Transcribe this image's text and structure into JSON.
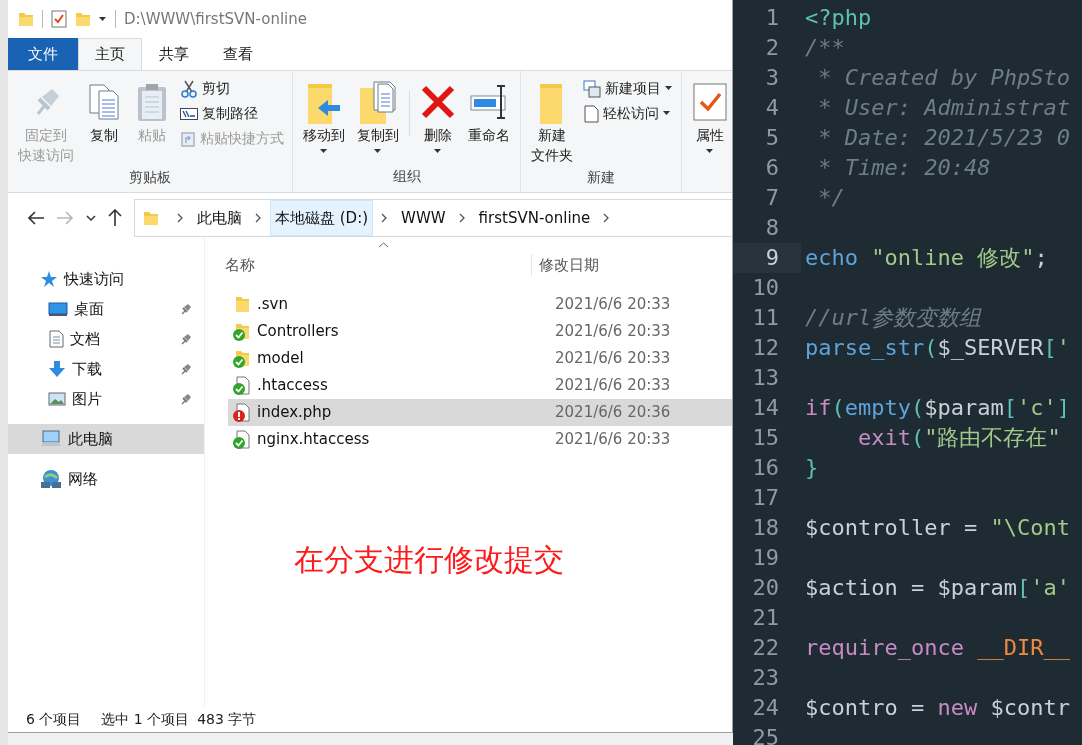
{
  "window": {
    "path": "D:\\WWW\\firstSVN-online"
  },
  "ribbon_tabs": [
    {
      "label": "文件",
      "kind": "file_menu",
      "selected": false
    },
    {
      "label": "主页",
      "kind": "tab",
      "selected": true
    },
    {
      "label": "共享",
      "kind": "tab",
      "selected": false
    },
    {
      "label": "查看",
      "kind": "tab",
      "selected": false
    }
  ],
  "ribbon_groups": [
    {
      "label": "剪贴板",
      "buttons": [
        {
          "kind": "large",
          "lines": [
            "固定到",
            "快速访问"
          ],
          "disabled": true,
          "dropdown": false
        },
        {
          "kind": "large",
          "lines": [
            "复制"
          ],
          "disabled": false,
          "dropdown": false
        },
        {
          "kind": "large",
          "lines": [
            "粘贴"
          ],
          "disabled": true,
          "dropdown": false
        },
        {
          "kind": "stack",
          "items": [
            {
              "label": "剪切",
              "disabled": false,
              "dropdown": false
            },
            {
              "label": "复制路径",
              "disabled": false,
              "dropdown": false
            },
            {
              "label": "粘贴快捷方式",
              "disabled": true,
              "dropdown": false
            }
          ]
        }
      ]
    },
    {
      "label": "组织",
      "buttons": [
        {
          "kind": "large",
          "lines": [
            "移动到"
          ],
          "disabled": false,
          "dropdown": true
        },
        {
          "kind": "large",
          "lines": [
            "复制到"
          ],
          "disabled": false,
          "dropdown": true
        },
        {
          "kind": "separator"
        },
        {
          "kind": "large",
          "lines": [
            "删除"
          ],
          "disabled": false,
          "dropdown": true
        },
        {
          "kind": "large",
          "lines": [
            "重命名"
          ],
          "disabled": false,
          "dropdown": false
        }
      ]
    },
    {
      "label": "新建",
      "buttons": [
        {
          "kind": "large",
          "lines": [
            "新建",
            "文件夹"
          ],
          "disabled": false,
          "dropdown": false
        },
        {
          "kind": "stack",
          "items": [
            {
              "label": "新建项目",
              "disabled": false,
              "dropdown": true
            },
            {
              "label": "轻松访问",
              "disabled": false,
              "dropdown": true
            }
          ]
        }
      ]
    },
    {
      "buttons": [
        {
          "kind": "large",
          "lines": [
            "属性"
          ],
          "disabled": false,
          "dropdown": true
        }
      ]
    }
  ],
  "navigation": {
    "back_enabled": true,
    "forward_enabled": false
  },
  "address": {
    "crumbs": [
      {
        "label": "此电脑",
        "highlighted": false
      },
      {
        "label": "本地磁盘 (D:)",
        "highlighted": true
      },
      {
        "label": "WWW",
        "highlighted": false
      },
      {
        "label": "firstSVN-online",
        "highlighted": false
      }
    ]
  },
  "sidebar": {
    "items": [
      {
        "label": "快速访问",
        "selected": false,
        "children": [
          {
            "label": "桌面",
            "pinned": true,
            "selected": false
          },
          {
            "label": "文档",
            "pinned": true,
            "selected": false
          },
          {
            "label": "下载",
            "pinned": true,
            "selected": false
          },
          {
            "label": "图片",
            "pinned": true,
            "selected": false
          }
        ]
      },
      {
        "label": "此电脑",
        "selected": true
      },
      {
        "label": "网络",
        "selected": false
      }
    ]
  },
  "columns": [
    {
      "label": "名称",
      "sorted": true
    },
    {
      "label": "修改日期",
      "sorted": false
    }
  ],
  "files": [
    {
      "name": ".svn",
      "date": "2021/6/6 20:33",
      "kind": "folder",
      "versioned": false,
      "modified": false,
      "selected": false
    },
    {
      "name": "Controllers",
      "date": "2021/6/6 20:33",
      "kind": "folder",
      "versioned": true,
      "modified": false,
      "selected": false
    },
    {
      "name": "model",
      "date": "2021/6/6 20:33",
      "kind": "folder",
      "versioned": true,
      "modified": false,
      "selected": false
    },
    {
      "name": ".htaccess",
      "date": "2021/6/6 20:33",
      "kind": "file",
      "versioned": true,
      "modified": false,
      "selected": false
    },
    {
      "name": "index.php",
      "date": "2021/6/6 20:36",
      "kind": "file",
      "versioned": true,
      "modified": true,
      "selected": true
    },
    {
      "name": "nginx.htaccess",
      "date": "2021/6/6 20:33",
      "kind": "file",
      "versioned": true,
      "modified": false,
      "selected": false
    }
  ],
  "annotation": "在分支进行修改提交",
  "status_bar": [
    "6 个项目",
    "选中 1 个项目",
    "483 字节"
  ],
  "editor": {
    "lines": [
      {
        "number": "1",
        "current": false,
        "tokens": [
          {
            "kind": "tag",
            "text": "<?php"
          }
        ]
      },
      {
        "number": "2",
        "current": false,
        "tokens": [
          {
            "kind": "comment",
            "text": "/**"
          }
        ]
      },
      {
        "number": "3",
        "current": false,
        "tokens": [
          {
            "kind": "comment",
            "text": " * Created by PhpSto"
          }
        ]
      },
      {
        "number": "4",
        "current": false,
        "tokens": [
          {
            "kind": "comment",
            "text": " * User: Administrat"
          }
        ]
      },
      {
        "number": "5",
        "current": false,
        "tokens": [
          {
            "kind": "comment",
            "text": " * Date: 2021/5/23 0"
          }
        ]
      },
      {
        "number": "6",
        "current": false,
        "tokens": [
          {
            "kind": "comment",
            "text": " * Time: 20:48"
          }
        ]
      },
      {
        "number": "7",
        "current": false,
        "tokens": [
          {
            "kind": "comment",
            "text": " */"
          }
        ]
      },
      {
        "number": "8",
        "current": false
      },
      {
        "number": "9",
        "current": true,
        "tokens": [
          {
            "kind": "keyword",
            "text": "echo"
          },
          {
            "kind": "string",
            "text": " \"online 修改\""
          },
          {
            "kind": "plain",
            "text": ";"
          }
        ]
      },
      {
        "number": "10",
        "current": false
      },
      {
        "number": "11",
        "current": false,
        "tokens": [
          {
            "kind": "comment",
            "text": "//url参数变数组"
          }
        ]
      },
      {
        "number": "12",
        "current": false,
        "tokens": [
          {
            "kind": "func",
            "text": "parse_str"
          },
          {
            "kind": "punct",
            "text": "("
          },
          {
            "kind": "var",
            "text": "$_SERVER"
          },
          {
            "kind": "punct",
            "text": "["
          },
          {
            "kind": "string",
            "text": "'"
          }
        ]
      },
      {
        "number": "13",
        "current": false
      },
      {
        "number": "14",
        "current": false,
        "tokens": [
          {
            "kind": "control",
            "text": "if"
          },
          {
            "kind": "punct",
            "text": "("
          },
          {
            "kind": "func",
            "text": "empty"
          },
          {
            "kind": "punct",
            "text": "("
          },
          {
            "kind": "var",
            "text": "$param"
          },
          {
            "kind": "punct",
            "text": "["
          },
          {
            "kind": "string",
            "text": "'c'"
          },
          {
            "kind": "punct",
            "text": "]"
          }
        ]
      },
      {
        "number": "15",
        "current": false,
        "tokens": [
          {
            "kind": "control",
            "text": "    exit"
          },
          {
            "kind": "punct",
            "text": "("
          },
          {
            "kind": "string",
            "text": "\"路由不存在\""
          }
        ]
      },
      {
        "number": "16",
        "current": false,
        "tokens": [
          {
            "kind": "punct",
            "text": "}"
          }
        ]
      },
      {
        "number": "17",
        "current": false
      },
      {
        "number": "18",
        "current": false,
        "tokens": [
          {
            "kind": "var",
            "text": "$controller"
          },
          {
            "kind": "plain",
            "text": " = "
          },
          {
            "kind": "string",
            "text": "\"\\Cont"
          }
        ]
      },
      {
        "number": "19",
        "current": false
      },
      {
        "number": "20",
        "current": false,
        "tokens": [
          {
            "kind": "var",
            "text": "$action"
          },
          {
            "kind": "plain",
            "text": " = "
          },
          {
            "kind": "var",
            "text": "$param"
          },
          {
            "kind": "punct",
            "text": "["
          },
          {
            "kind": "string",
            "text": "'a'"
          }
        ]
      },
      {
        "number": "21",
        "current": false
      },
      {
        "number": "22",
        "current": false,
        "tokens": [
          {
            "kind": "control",
            "text": "require_once"
          },
          {
            "kind": "const",
            "text": " __DIR__"
          }
        ]
      },
      {
        "number": "23",
        "current": false
      },
      {
        "number": "24",
        "current": false,
        "tokens": [
          {
            "kind": "var",
            "text": "$contro"
          },
          {
            "kind": "plain",
            "text": " = "
          },
          {
            "kind": "control",
            "text": "new"
          },
          {
            "kind": "var",
            "text": " $contr"
          }
        ]
      },
      {
        "number": "25",
        "current": false
      }
    ]
  }
}
